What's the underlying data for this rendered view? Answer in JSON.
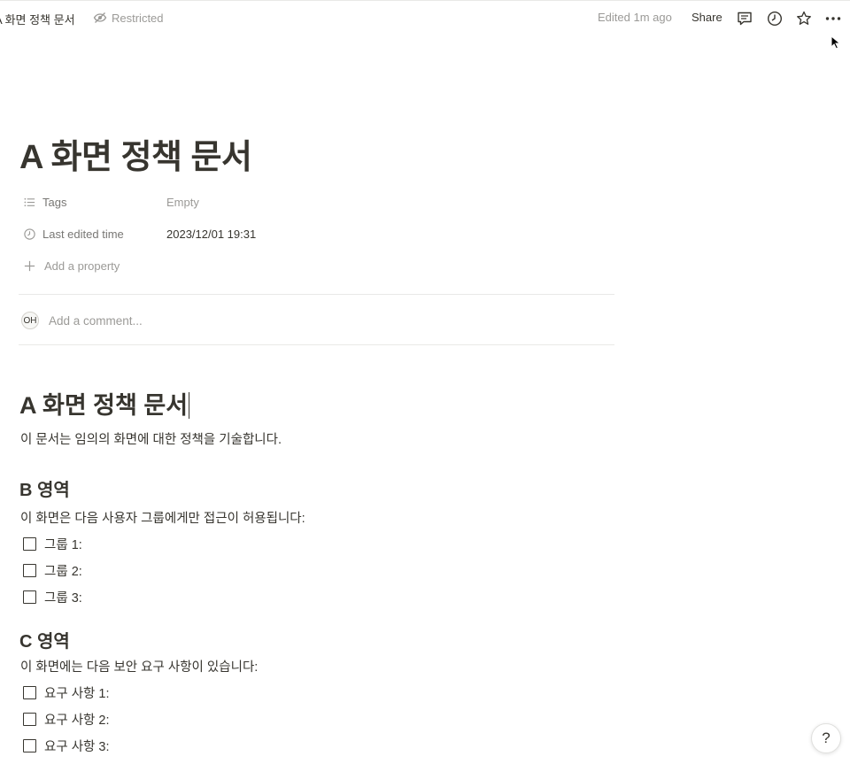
{
  "topbar": {
    "breadcrumb": "A 화면 정책 문서",
    "restricted_label": "Restricted",
    "edited_label": "Edited 1m ago",
    "share_label": "Share",
    "icons": [
      "comment-icon",
      "clock-icon",
      "star-icon",
      "more-icon"
    ]
  },
  "page": {
    "title": "A 화면 정책 문서"
  },
  "properties": [
    {
      "icon": "list-icon",
      "name": "Tags",
      "value": "Empty",
      "empty": true
    },
    {
      "icon": "clock-icon",
      "name": "Last edited time",
      "value": "2023/12/01 19:31",
      "empty": false
    }
  ],
  "add_property_label": "Add a property",
  "comment": {
    "avatar_text": "OH",
    "placeholder": "Add a comment..."
  },
  "body": {
    "heading": "A 화면 정책 문서",
    "intro": "이 문서는 임의의 화면에 대한 정책을 기술합니다.",
    "section_b": {
      "heading": "B 영역",
      "text": "이 화면은 다음 사용자 그룹에게만 접근이 허용됩니다:",
      "todos": [
        "그룹 1:",
        "그룹 2:",
        "그룹 3:"
      ]
    },
    "section_c": {
      "heading": "C 영역",
      "text": "이 화면에는 다음 보안 요구 사항이 있습니다:",
      "todos": [
        "요구 사항 1:",
        "요구 사항 2:",
        "요구 사항 3:"
      ]
    }
  },
  "help_label": "?"
}
